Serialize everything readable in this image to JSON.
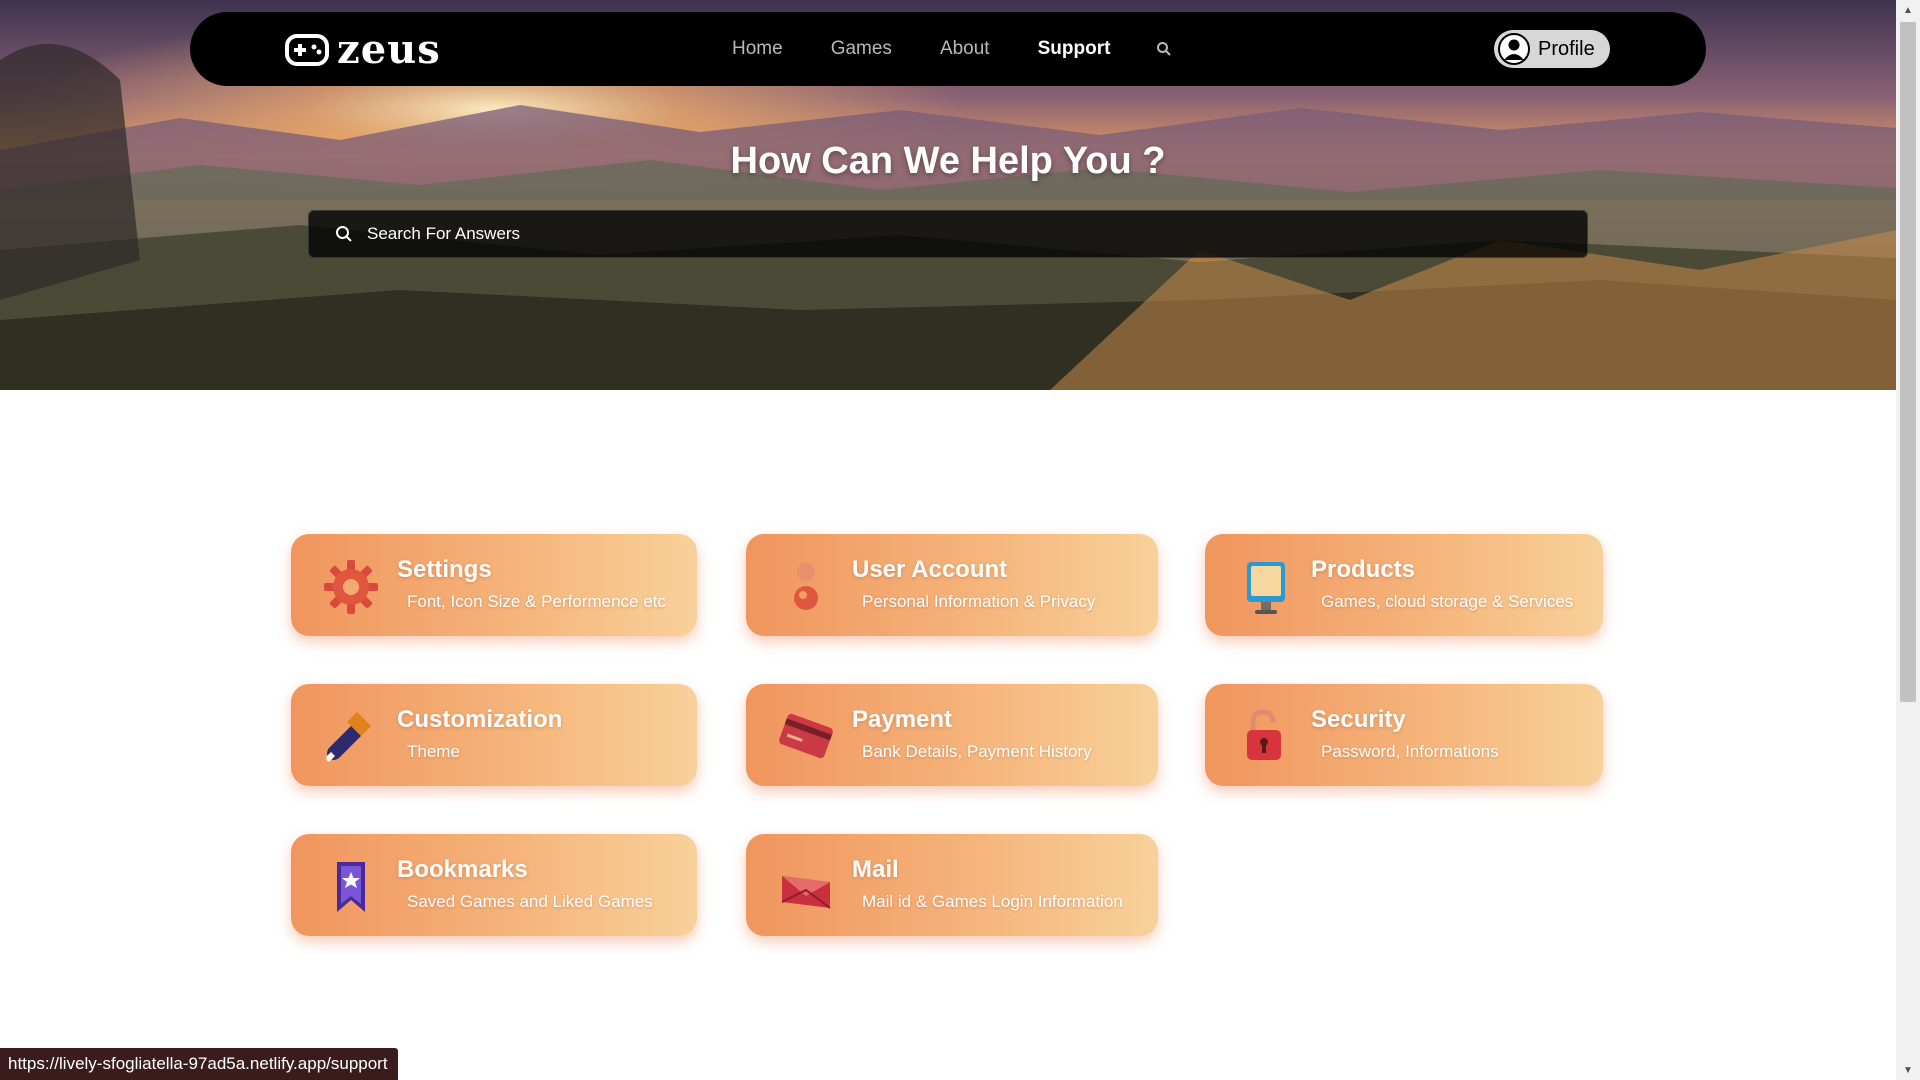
{
  "header": {
    "logo_text": "zeus",
    "nav": [
      "Home",
      "Games",
      "About",
      "Support"
    ],
    "active_nav": "Support",
    "profile_label": "Profile"
  },
  "hero": {
    "title": "How Can We Help You ?",
    "search_placeholder": "Search For Answers"
  },
  "categories": [
    {
      "title": "Settings",
      "description": "Font, Icon Size & Performence etc",
      "icon": "gear-icon"
    },
    {
      "title": "User Account",
      "description": "Personal Information & Privacy",
      "icon": "user-icon"
    },
    {
      "title": "Products",
      "description": "Games, cloud storage & Services",
      "icon": "monitor-icon"
    },
    {
      "title": "Customization",
      "description": "Theme",
      "icon": "paintbrush-icon"
    },
    {
      "title": "Payment",
      "description": "Bank Details, Payment History",
      "icon": "credit-card-icon"
    },
    {
      "title": "Security",
      "description": "Password, Informations",
      "icon": "padlock-icon"
    },
    {
      "title": "Bookmarks",
      "description": "Saved Games and Liked Games",
      "icon": "bookmark-icon"
    },
    {
      "title": "Mail",
      "description": "Mail id & Games Login Information",
      "icon": "envelope-icon"
    }
  ],
  "status_url": "https://lively-sfogliatella-97ad5a.netlify.app/support",
  "colors": {
    "navbar": "#000000",
    "card_start": "#f0955e",
    "card_end": "#f8d19a",
    "status_bar": "#3a1c1c"
  }
}
